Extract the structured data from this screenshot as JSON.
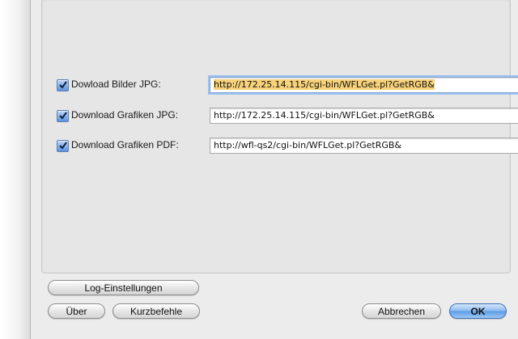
{
  "downloads": [
    {
      "label": "Dowload Bilder JPG:",
      "checked": true,
      "url": "http://172.25.14.115/cgi-bin/WFLGet.pl?GetRGB&",
      "selected": true
    },
    {
      "label": "Download Grafiken JPG:",
      "checked": true,
      "url": "http://172.25.14.115/cgi-bin/WFLGet.pl?GetRGB&",
      "selected": false
    },
    {
      "label": "Download Grafiken PDF:",
      "checked": true,
      "url": "http://wfl-qs2/cgi-bin/WFLGet.pl?GetRGB&",
      "selected": false
    }
  ],
  "buttons": {
    "log_settings": "Log-Einstellungen",
    "about": "Über",
    "shortcuts": "Kurzbefehle",
    "cancel": "Abbrechen",
    "ok": "OK"
  },
  "colors": {
    "selection_highlight": "#f7d27a",
    "checkbox_blue": "#5b92de",
    "default_button_blue": "#5c9be6",
    "panel_background": "#ececec"
  }
}
